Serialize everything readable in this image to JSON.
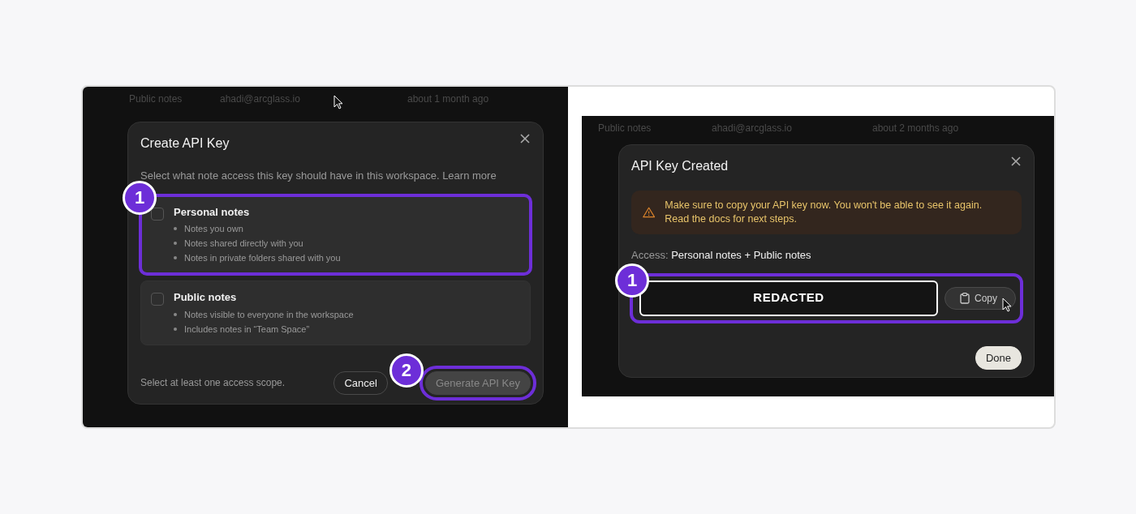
{
  "left_panel": {
    "background_row": {
      "column_1": "Public notes",
      "column_2": "ahadi@arcglass.io",
      "column_3": "about 1 month ago"
    },
    "dialog": {
      "title": "Create API Key",
      "description": "Select what note access this key should have in this workspace.",
      "link": "Learn more",
      "scopes": [
        {
          "label": "Personal notes",
          "checked": false,
          "marker": "1",
          "items": [
            "Notes you own",
            "Notes shared directly with you",
            "Notes in private folders shared with you"
          ]
        },
        {
          "label": "Public notes",
          "checked": false,
          "items": [
            "Notes visible to everyone in the workspace",
            "Includes notes in “Team Space”"
          ]
        }
      ],
      "hint": "Select at least one access scope.",
      "buttons": [
        {
          "label": "Cancel",
          "kind": "secondary",
          "disabled": false
        },
        {
          "label": "Generate API Key",
          "kind": "primary",
          "disabled": true,
          "marker": "2"
        }
      ]
    }
  },
  "right_panel": {
    "background_row": {
      "column_1": "Public notes",
      "column_2": "ahadi@arcglass.io",
      "column_3": "about 2 months ago"
    },
    "dialog": {
      "title": "API Key Created",
      "warning": "Make sure to copy your API key now. You won't be able to see it again.",
      "warning_link": "Read the docs",
      "warning_suffix": "for next steps.",
      "access_label": "Access:",
      "access_value": "Personal notes + Public notes",
      "key": {
        "value": "REDACTED",
        "marker": "1",
        "copy_button": "Copy"
      },
      "buttons": [
        {
          "label": "Done",
          "kind": "light",
          "disabled": false
        }
      ]
    }
  }
}
